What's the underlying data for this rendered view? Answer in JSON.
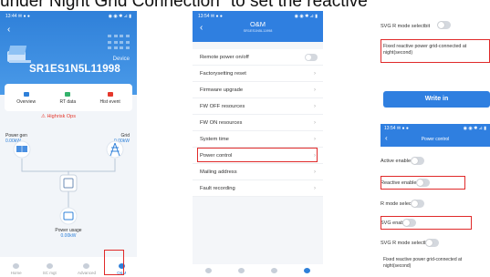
{
  "doc_title": "under Night Grid Connection\" to set the reactive",
  "colors": {
    "brand": "#2f7fe0",
    "alert": "#e5382c",
    "highlight_box": "#e02a2a",
    "toggle_off": "#d4d8de"
  },
  "phone1": {
    "status_time": "13:44 ✉ ● ●",
    "status_icons": "◉ ◉ ✱ ⊿ ▮",
    "device_label": "Device",
    "device_sn": "SR1ES1N5L11998",
    "tabs": [
      {
        "label": "Overview",
        "icon": "overview-icon",
        "color": "#2f80d9"
      },
      {
        "label": "RT data",
        "icon": "rt-data-icon",
        "color": "#33b26b"
      },
      {
        "label": "Hist event",
        "icon": "hist-event-icon",
        "color": "#e5382c"
      }
    ],
    "alarm": "⚠ Highrisk Ops",
    "power_gen": {
      "label": "Power gen",
      "value": "0.00kW"
    },
    "grid": {
      "label": "Grid",
      "value": "0.00kW"
    },
    "power_usage": {
      "label": "Power usage",
      "value": "0.00kW"
    },
    "nav": [
      "Home",
      "SC mgt",
      "Advanced",
      "O&M"
    ]
  },
  "phone2": {
    "status_time": "13:54 ✉ ● ●",
    "status_icons": "◉ ◉ ✱ ⊿ ▮",
    "title": "O&M",
    "subtitle": "SR1ES1N5L11998",
    "menu": [
      "Remote power on/off",
      "Factorysetting reset",
      "Firmware upgrade",
      "FW OFF resources",
      "FW ON resources",
      "System time",
      "Power control",
      "Mailing address",
      "Fault recording"
    ]
  },
  "panel3": {
    "top_svg_r_label": "SVG R mode selectbit",
    "fixed_reactive_label": "Fixed reactive power grid-connected at night(second)",
    "write_button": "Write in",
    "status_time": "13:54 ✉ ● ●",
    "status_icons": "◉ ◉ ✱ ⊿ ▮",
    "header_title": "Power control",
    "rows": [
      "Active enable bit",
      "Reactive enable bit",
      "R mode select bit",
      "SVG enable bit",
      "SVG R mode selectbit"
    ],
    "bottom_fixed_label": "Fixed reactive power grid-connected at night(second)"
  }
}
